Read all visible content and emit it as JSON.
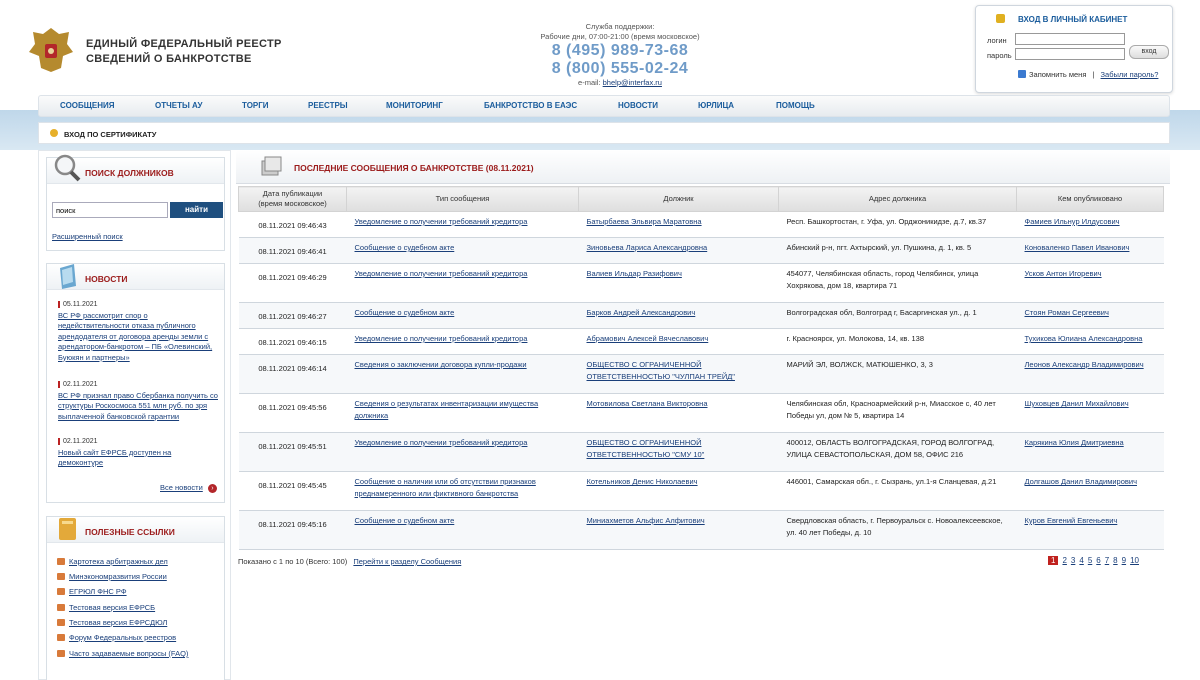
{
  "header": {
    "site_title_1": "ЕДИНЫЙ ФЕДЕРАЛЬНЫЙ РЕЕСТР",
    "site_title_2": "СВЕДЕНИЙ О БАНКРОТСТВЕ",
    "support_label": "Служба поддержки:",
    "support_hours": "Рабочие дни, 07:00-21:00 (время московское)",
    "phone_1": "8 (495) 989-73-68",
    "phone_2": "8 (800) 555-02-24",
    "email_label": "e-mail:",
    "email": "bhelp@interfax.ru"
  },
  "login": {
    "title": "ВХОД В ЛИЧНЫЙ КАБИНЕТ",
    "login_label": "логин",
    "password_label": "пароль",
    "enter_button": "вход",
    "remember_label": "Запомнить меня",
    "separator": "|",
    "forgot_link": "Забыли пароль?"
  },
  "nav": {
    "items": [
      "СООБЩЕНИЯ",
      "ОТЧЕТЫ АУ",
      "ТОРГИ",
      "РЕЕСТРЫ",
      "МОНИТОРИНГ",
      "БАНКРОТСТВО В ЕАЭС",
      "НОВОСТИ",
      "ЮРЛИЦА",
      "ПОМОЩЬ"
    ]
  },
  "cert": {
    "label": "ВХОД ПО СЕРТИФИКАТУ"
  },
  "search": {
    "title": "ПОИСК ДОЛЖНИКОВ",
    "input_value": "поиск",
    "button": "найти",
    "advanced_link": "Расширенный поиск"
  },
  "news": {
    "title": "НОВОСТИ",
    "items": [
      {
        "date": "05.11.2021",
        "text": "ВС РФ рассмотрит спор о недействительности отказа публичного арендодателя от договора аренды земли с арендатором-банкротом – ПБ «Олевинский, Буюкян и партнеры»"
      },
      {
        "date": "02.11.2021",
        "text": "ВС РФ признал право Сбербанка получить со структуры Роскосмоса 551 млн руб. по зря выплаченной банковской гарантии"
      },
      {
        "date": "02.11.2021",
        "text": "Новый сайт ЕФРСБ доступен на демоконтуре"
      }
    ],
    "all_link": "Все новости"
  },
  "useful_links": {
    "title": "ПОЛЕЗНЫЕ ССЫЛКИ",
    "items": [
      "Картотека арбитражных дел",
      "Минэкономразвития России",
      "ЕГРЮЛ ФНС РФ",
      "Тестовая версия ЕФРСБ",
      "Тестовая версия ЕФРСДЮЛ",
      "Форум Федеральных реестров",
      "Часто задаваемые вопросы (FAQ)"
    ]
  },
  "messages": {
    "title": "ПОСЛЕДНИЕ СООБЩЕНИЯ О БАНКРОТСТВЕ (08.11.2021)",
    "columns": {
      "date_1": "Дата публикации",
      "date_2": "(время московское)",
      "type": "Тип сообщения",
      "debtor": "Должник",
      "address": "Адрес должника",
      "publisher": "Кем опубликовано"
    },
    "rows": [
      {
        "date": "08.11.2021 09:46:43",
        "type": "Уведомление о получении требований кредитора",
        "debtor": "Батырбаева Эльвира Маратовна",
        "address": "Респ. Башкортостан, г. Уфа, ул. Орджоникидзе, д.7, кв.37",
        "publisher": "Фамиев Ильнур Илдусович"
      },
      {
        "date": "08.11.2021 09:46:41",
        "type": "Сообщение о судебном акте",
        "debtor": "Зиновьева Лариса Александровна",
        "address": "Абинский р-н, пгт. Ахтырский, ул. Пушкина, д. 1, кв. 5",
        "publisher": "Коноваленко Павел Иванович"
      },
      {
        "date": "08.11.2021 09:46:29",
        "type": "Уведомление о получении требований кредитора",
        "debtor": "Валиев Ильдар Разифович",
        "address": "454077, Челябинская область, город Челябинск, улица Хохрякова, дом 18, квартира 71",
        "publisher": "Усков Антон Игоревич"
      },
      {
        "date": "08.11.2021 09:46:27",
        "type": "Сообщение о судебном акте",
        "debtor": "Барков Андрей Александрович",
        "address": "Волгоградская обл, Волгоград г, Басаргинская ул., д. 1",
        "publisher": "Стоян Роман Сергеевич"
      },
      {
        "date": "08.11.2021 09:46:15",
        "type": "Уведомление о получении требований кредитора",
        "debtor": "Абрамович Алексей Вячеславович",
        "address": "г. Красноярск, ул. Молокова, 14, кв. 138",
        "publisher": "Тухикова Юлиана Александровна"
      },
      {
        "date": "08.11.2021 09:46:14",
        "type": "Сведения о заключении договора купли-продажи",
        "debtor": "ОБЩЕСТВО С ОГРАНИЧЕННОЙ ОТВЕТСТВЕННОСТЬЮ \"ЧУЛПАН ТРЕЙД\"",
        "address": "МАРИЙ ЭЛ, ВОЛЖСК, МАТЮШЕНКО, 3, 3",
        "publisher": "Леонов Александр Владимирович"
      },
      {
        "date": "08.11.2021 09:45:56",
        "type": "Сведения о результатах инвентаризации имущества должника",
        "debtor": "Мотовилова Светлана Викторовна",
        "address": "Челябинская обл, Красноармейский р-н, Миасское с, 40 лет Победы ул, дом № 5, квартира 14",
        "publisher": "Шуховцев Данил Михайлович"
      },
      {
        "date": "08.11.2021 09:45:51",
        "type": "Уведомление о получении требований кредитора",
        "debtor": "ОБЩЕСТВО С ОГРАНИЧЕННОЙ ОТВЕТСТВЕННОСТЬЮ \"СМУ 10\"",
        "address": "400012, ОБЛАСТЬ ВОЛГОГРАДСКАЯ, ГОРОД ВОЛГОГРАД, УЛИЦА СЕВАСТОПОЛЬСКАЯ, ДОМ 58, ОФИС 216",
        "publisher": "Карякина Юлия Дмитриевна"
      },
      {
        "date": "08.11.2021 09:45:45",
        "type": "Сообщение о наличии или об отсутствии признаков преднамеренного или фиктивного банкротства",
        "debtor": "Котельников Денис Николаевич",
        "address": "446001, Самарская обл., г. Сызрань, ул.1-я Сланцевая, д.21",
        "publisher": "Долгашов Данил Владимирович"
      },
      {
        "date": "08.11.2021 09:45:16",
        "type": "Сообщение о судебном акте",
        "debtor": "Миниахметов Альфис Алфитович",
        "address": "Свердловская область, г. Первоуральск с. Новоалексеевское, ул. 40 лет Победы, д. 10",
        "publisher": "Куров Евгений Евгеньевич"
      }
    ],
    "shown_text": "Показано с 1 по 10 (Всего: 100)",
    "goto_link": "Перейти к разделу Сообщения",
    "pages": [
      "1",
      "2",
      "3",
      "4",
      "5",
      "6",
      "7",
      "8",
      "9",
      "10"
    ],
    "current_page": "1"
  }
}
